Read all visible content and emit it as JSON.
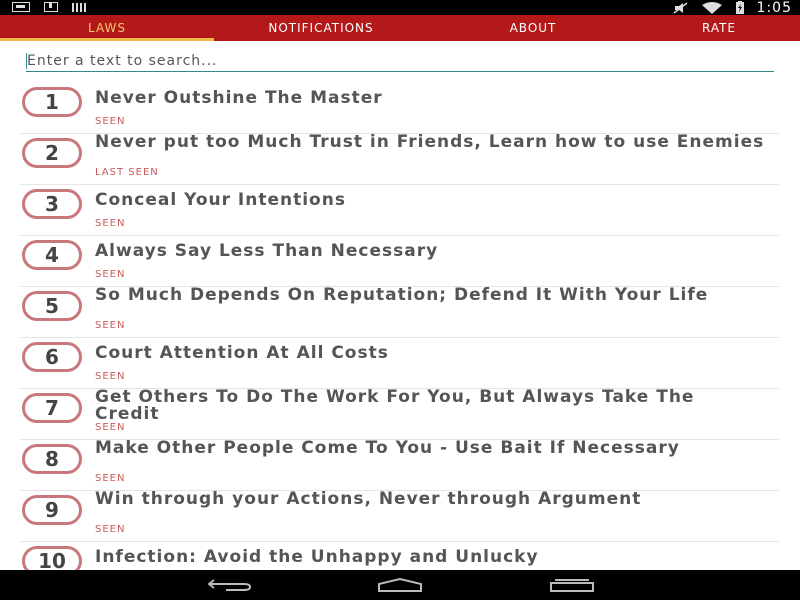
{
  "status_bar": {
    "time": "1:05",
    "icons": [
      "photo-icon",
      "download-icon",
      "signal-bars-icon",
      "mute-icon",
      "wifi-icon",
      "battery-icon"
    ]
  },
  "tabs": [
    {
      "label": "LAWS",
      "active": true
    },
    {
      "label": "NOTIFICATIONS",
      "active": false
    },
    {
      "label": "ABOUT",
      "active": false
    },
    {
      "label": "RATE",
      "active": false
    }
  ],
  "search": {
    "placeholder": "Enter a text to search...",
    "value": ""
  },
  "laws": [
    {
      "number": "1",
      "title": "Never Outshine The Master",
      "status": "SEEN"
    },
    {
      "number": "2",
      "title": "Never put too Much Trust in Friends, Learn how to use Enemies",
      "status": "LAST SEEN"
    },
    {
      "number": "3",
      "title": "Conceal Your Intentions",
      "status": "SEEN"
    },
    {
      "number": "4",
      "title": "Always Say Less Than Necessary",
      "status": "SEEN"
    },
    {
      "number": "5",
      "title": "So Much Depends On Reputation; Defend It With Your Life",
      "status": "SEEN"
    },
    {
      "number": "6",
      "title": "Court Attention At All Costs",
      "status": "SEEN"
    },
    {
      "number": "7",
      "title": "Get Others To Do The Work For You, But Always Take The Credit",
      "status": "SEEN"
    },
    {
      "number": "8",
      "title": "Make Other People Come To You - Use Bait If Necessary",
      "status": "SEEN"
    },
    {
      "number": "9",
      "title": "Win through your Actions, Never through Argument",
      "status": "SEEN"
    },
    {
      "number": "10",
      "title": "Infection: Avoid the Unhappy and Unlucky",
      "status": ""
    }
  ],
  "colors": {
    "accent": "#b31919",
    "tab_active_text": "#f5c86a",
    "tab_indicator": "#f2b64b",
    "number_ring": "#c8787c",
    "status_text": "#c85a5a",
    "search_underline": "#2e8b87"
  },
  "nav_bar": {
    "icons": [
      "back-icon",
      "home-icon",
      "recents-icon"
    ]
  }
}
